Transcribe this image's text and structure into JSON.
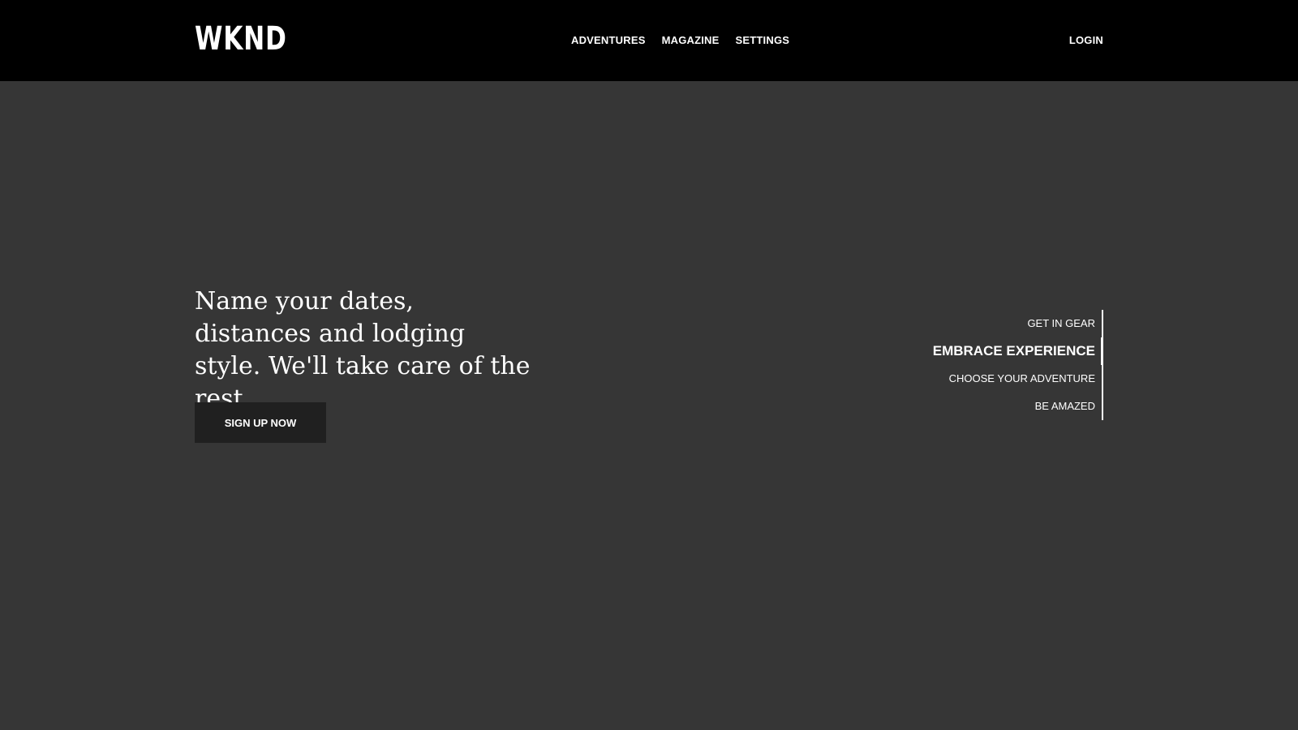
{
  "header": {
    "logo_text": "WKND",
    "nav": [
      {
        "label": "ADVENTURES"
      },
      {
        "label": "MAGAZINE"
      },
      {
        "label": "SETTINGS"
      }
    ],
    "login_label": "LOGIN"
  },
  "hero": {
    "heading": "Name your dates, distances and lodging style. We'll take care of the rest.",
    "cta_label": "SIGN UP NOW"
  },
  "steps": [
    {
      "label": "GET IN GEAR",
      "active": false
    },
    {
      "label": "EMBRACE EXPERIENCE",
      "active": true
    },
    {
      "label": "CHOOSE YOUR ADVENTURE",
      "active": false
    },
    {
      "label": "BE AMAZED",
      "active": false
    }
  ],
  "colors": {
    "header_bg": "#000000",
    "page_bg": "#363636",
    "button_bg": "#202020",
    "text": "#ffffff"
  }
}
